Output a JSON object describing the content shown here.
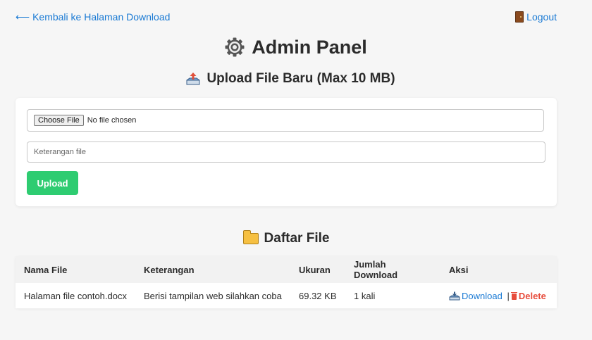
{
  "nav": {
    "back_label": "Kembali ke Halaman Download",
    "logout_label": "Logout"
  },
  "header": {
    "title": "Admin Panel"
  },
  "upload": {
    "title": "Upload File Baru (Max 10 MB)",
    "choose_label": "Choose File",
    "no_file_text": "No file chosen",
    "description_placeholder": "Keterangan file",
    "description_value": "",
    "submit_label": "Upload"
  },
  "files": {
    "title": "Daftar File",
    "columns": [
      "Nama File",
      "Keterangan",
      "Ukuran",
      "Jumlah Download",
      "Aksi"
    ],
    "rows": [
      {
        "name": "Halaman file contoh.docx",
        "description": "Berisi tampilan web silahkan coba",
        "size": "69.32 KB",
        "downloads": "1 kali",
        "download_label": "Download",
        "separator": "|",
        "delete_label": "Delete"
      }
    ]
  },
  "colors": {
    "link": "#1a7ad4",
    "upload_button": "#2ecc71",
    "delete": "#e74c3c"
  }
}
